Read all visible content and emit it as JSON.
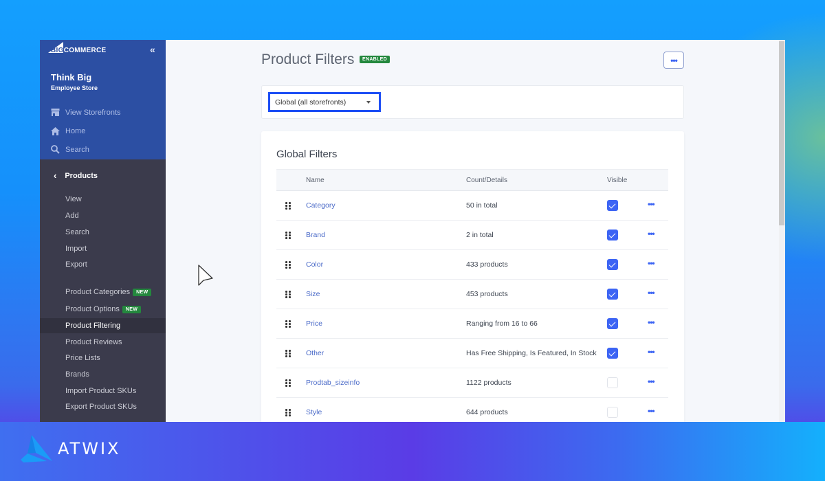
{
  "sidebar": {
    "logo": {
      "part1": "BIG",
      "part2": "COMMERCE"
    },
    "collapse_icon": "double-chevron-left-icon",
    "store_name": "Think Big",
    "store_subtitle": "Employee Store",
    "top_links": [
      {
        "label": "View Storefronts",
        "icon": "storefront-icon"
      },
      {
        "label": "Home",
        "icon": "home-icon"
      },
      {
        "label": "Search",
        "icon": "search-icon"
      }
    ],
    "section_title": "Products",
    "items": [
      {
        "label": "View"
      },
      {
        "label": "Add"
      },
      {
        "label": "Search"
      },
      {
        "label": "Import"
      },
      {
        "label": "Export"
      },
      {
        "label": "Product Categories",
        "badge": "NEW"
      },
      {
        "label": "Product Options",
        "badge": "NEW"
      },
      {
        "label": "Product Filtering",
        "active": true
      },
      {
        "label": "Product Reviews"
      },
      {
        "label": "Price Lists"
      },
      {
        "label": "Brands"
      },
      {
        "label": "Import Product SKUs"
      },
      {
        "label": "Export Product SKUs"
      }
    ]
  },
  "header": {
    "title": "Product Filters",
    "status_badge": "ENABLED",
    "more_label": "•••"
  },
  "storefront_select": {
    "value": "Global (all storefronts)"
  },
  "filters": {
    "title": "Global Filters",
    "columns": {
      "name": "Name",
      "count": "Count/Details",
      "visible": "Visible"
    },
    "rows": [
      {
        "name": "Category",
        "count": "50 in total",
        "visible": true
      },
      {
        "name": "Brand",
        "count": "2 in total",
        "visible": true
      },
      {
        "name": "Color",
        "count": "433 products",
        "visible": true
      },
      {
        "name": "Size",
        "count": "453 products",
        "visible": true
      },
      {
        "name": "Price",
        "count": "Ranging from 16 to 66",
        "visible": true
      },
      {
        "name": "Other",
        "count": "Has Free Shipping, Is Featured, In Stock",
        "visible": true
      },
      {
        "name": "Prodtab_sizeinfo",
        "count": "1122 products",
        "visible": false
      },
      {
        "name": "Style",
        "count": "644 products",
        "visible": false
      }
    ],
    "row_more_label": "•••"
  },
  "branding": {
    "text": "ATWIX"
  },
  "colors": {
    "accent": "#3c64f4",
    "sidebar_top": "#2c4fa3",
    "sidebar": "#3b3b4c",
    "badge_green": "#24883e",
    "select_highlight": "#1d4ef5"
  }
}
